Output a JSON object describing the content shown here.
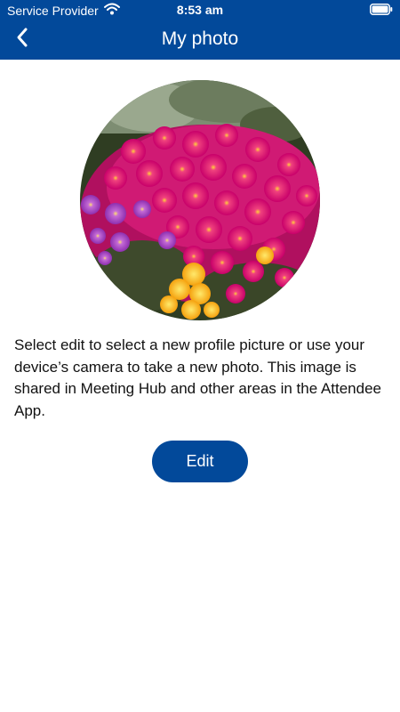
{
  "status_bar": {
    "carrier": "Service Provider",
    "time": "8:53 am",
    "wifi_icon": "wifi-icon",
    "battery_icon": "battery-icon"
  },
  "header": {
    "title": "My photo",
    "back_icon": "chevron-left-icon"
  },
  "profile_photo": {
    "subject": "pink-flowers-photo"
  },
  "main": {
    "description": "Select edit to select a new profile picture or use your device’s camera to take a new photo. This image is shared in Meeting Hub and other areas in the Attendee App.",
    "edit_label": "Edit"
  },
  "colors": {
    "brand": "#02499a",
    "background": "#ffffff",
    "text": "#111111"
  }
}
